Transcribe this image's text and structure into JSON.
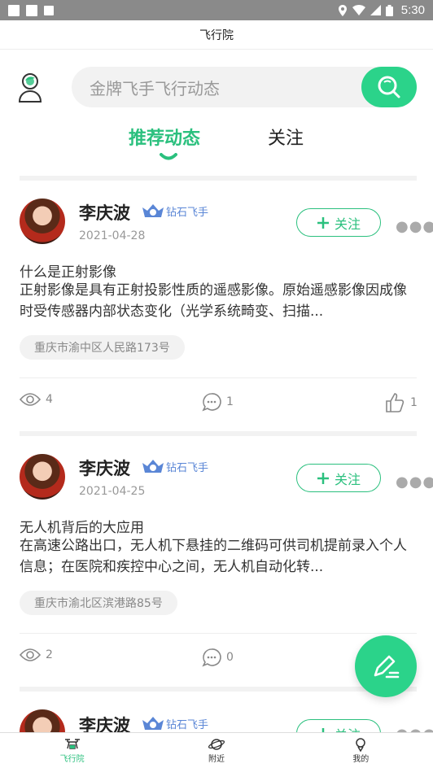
{
  "status_bar": {
    "time": "5:30"
  },
  "title_bar": {
    "title": "飞行院"
  },
  "search": {
    "placeholder": "金牌飞手飞行动态"
  },
  "tabs": [
    {
      "label": "推荐动态",
      "active": true
    },
    {
      "label": "关注",
      "active": false
    }
  ],
  "posts": [
    {
      "author": "李庆波",
      "badge": "钻石飞手",
      "date": "2021-04-28",
      "follow_label": "关注",
      "title": "什么是正射影像",
      "body": "正射影像是具有正射投影性质的遥感影像。原始遥感影像因成像时受传感器内部状态变化（光学系统畸变、扫描...",
      "location": "重庆市渝中区人民路173号",
      "views": "4",
      "comments": "1",
      "likes": "1"
    },
    {
      "author": "李庆波",
      "badge": "钻石飞手",
      "date": "2021-04-25",
      "follow_label": "关注",
      "title": "无人机背后的大应用",
      "body": "在高速公路出口，无人机下悬挂的二维码可供司机提前录入个人信息；在医院和疾控中心之间，无人机自动化转...",
      "location": "重庆市渝北区滨港路85号",
      "views": "2",
      "comments": "0",
      "likes": ""
    },
    {
      "author": "李庆波",
      "badge": "钻石飞手",
      "follow_label": "关注"
    }
  ],
  "bottom_nav": [
    {
      "label": "飞行院",
      "icon": "drone-icon",
      "active": true
    },
    {
      "label": "附近",
      "icon": "planet-icon",
      "active": false
    },
    {
      "label": "我的",
      "icon": "profile-icon",
      "active": false
    }
  ],
  "colors": {
    "accent": "#2bc07e",
    "fab": "#2bd38a",
    "badge": "#5a86d6"
  }
}
